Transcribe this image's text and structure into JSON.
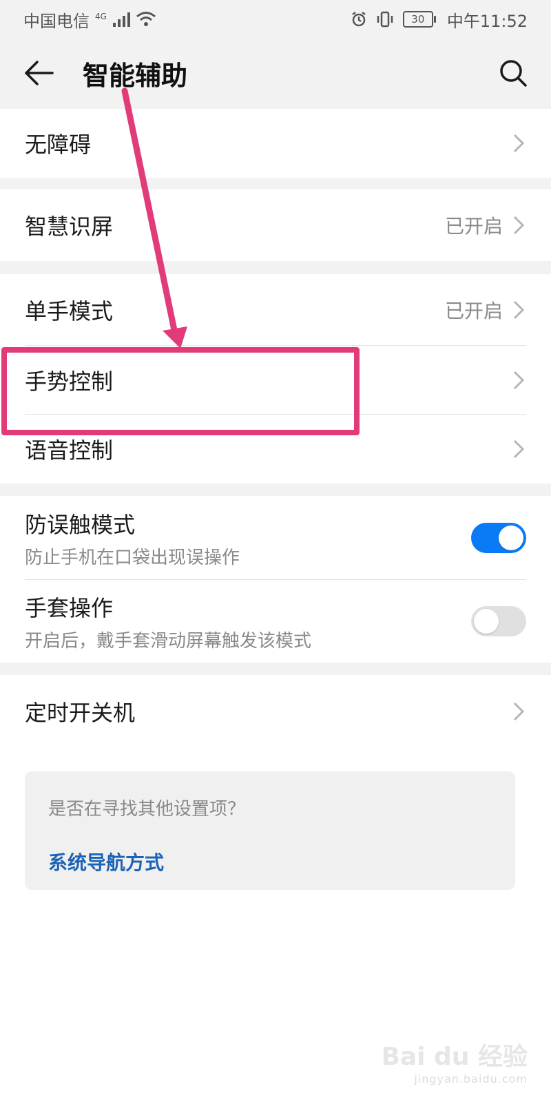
{
  "status": {
    "carrier": "中国电信",
    "network": "4G",
    "battery": "30",
    "time": "中午11:52"
  },
  "appbar": {
    "title": "智能辅助"
  },
  "items": {
    "accessibility": {
      "label": "无障碍"
    },
    "smart_screen": {
      "label": "智慧识屏",
      "value": "已开启"
    },
    "one_hand": {
      "label": "单手模式",
      "value": "已开启"
    },
    "gesture": {
      "label": "手势控制"
    },
    "voice": {
      "label": "语音控制"
    },
    "anti_touch": {
      "label": "防误触模式",
      "sub": "防止手机在口袋出现误操作",
      "enabled": true
    },
    "glove": {
      "label": "手套操作",
      "sub": "开启后，戴手套滑动屏幕触发该模式",
      "enabled": false
    },
    "scheduled_power": {
      "label": "定时开关机"
    }
  },
  "suggestion": {
    "question": "是否在寻找其他设置项？",
    "link": "系统导航方式"
  },
  "colors": {
    "accent": "#0a7bf5",
    "highlight": "#e23b7a",
    "link": "#1b63b8"
  },
  "watermark": {
    "brand": "Bai du 经验",
    "url": "jingyan.baidu.com"
  }
}
